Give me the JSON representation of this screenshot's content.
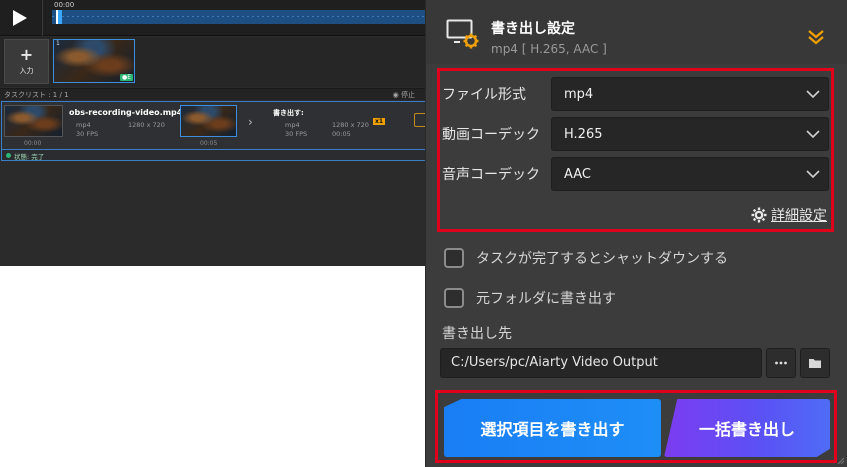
{
  "editor": {
    "timeline_time": "00:00",
    "add_button_label": "入力",
    "media_thumb_badge": "●E",
    "media_thumb_index": "1",
    "task_count": "タスクリスト : 1 / 1",
    "stop_label": "◉ 停止",
    "task": {
      "filename": "obs-recording-video.mp4",
      "format": "mp4",
      "resolution": "1280 x 720",
      "fps": "30 FPS",
      "start_time": "00:00",
      "duration": "00:05",
      "output_label": "書き出す:",
      "out_format": "mp4",
      "out_resolution": "1280 x 720",
      "out_fps": "30 FPS",
      "out_duration": "00:05",
      "multiplier": "x1",
      "status": "状態: 完了"
    }
  },
  "panel": {
    "title": "書き出し設定",
    "subtitle": "mp4 [ H.265, AAC ]",
    "format_label": "ファイル形式",
    "format_value": "mp4",
    "video_codec_label": "動画コーデック",
    "video_codec_value": "H.265",
    "audio_codec_label": "音声コーデック",
    "audio_codec_value": "AAC",
    "advanced_label": "詳細設定",
    "shutdown_label": "タスクが完了するとシャットダウンする",
    "source_folder_label": "元フォルダに書き出す",
    "output_dir_label": "書き出し先",
    "output_dir_value": "C:/Users/pc/Aiarty Video Output",
    "export_selected_label": "選択項目を書き出す",
    "export_all_label": "一括書き出し"
  },
  "colors": {
    "accent_blue": "#1a7ef5",
    "accent_purple": "#7b3cf0",
    "highlight_red": "#e0001b",
    "gear_orange": "#f0a000"
  }
}
